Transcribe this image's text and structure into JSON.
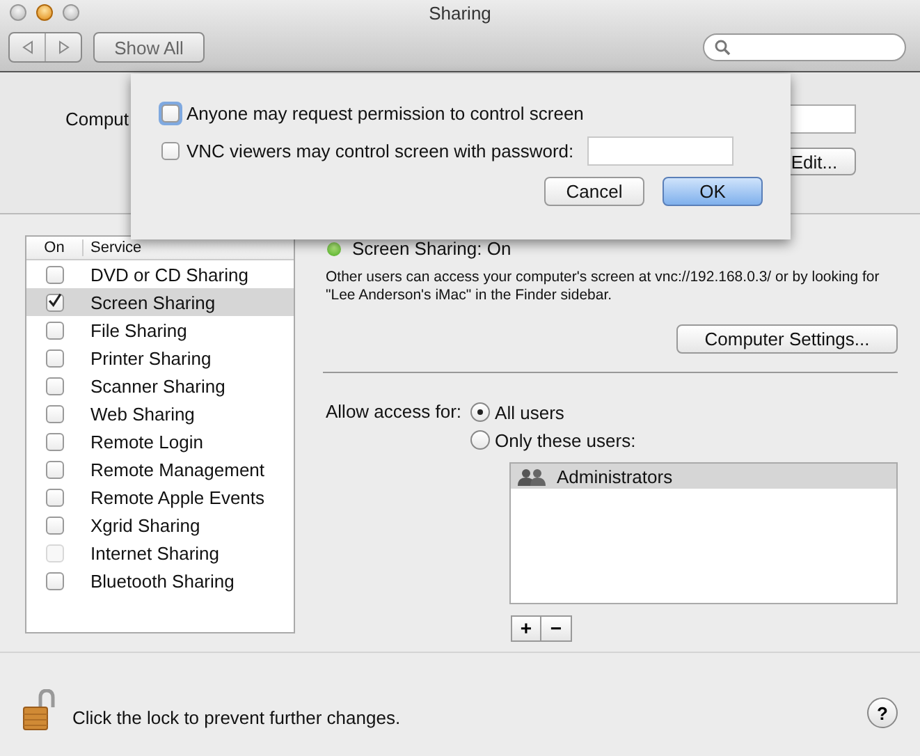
{
  "window": {
    "title": "Sharing"
  },
  "toolbar": {
    "show_all": "Show All"
  },
  "computer_name": {
    "label": "Comput",
    "edit_button": "Edit..."
  },
  "services": {
    "columns": [
      "On",
      "Service"
    ],
    "items": [
      {
        "name": "DVD or CD Sharing",
        "checked": false,
        "selected": false,
        "disabled": false
      },
      {
        "name": "Screen Sharing",
        "checked": true,
        "selected": true,
        "disabled": false
      },
      {
        "name": "File Sharing",
        "checked": false,
        "selected": false,
        "disabled": false
      },
      {
        "name": "Printer Sharing",
        "checked": false,
        "selected": false,
        "disabled": false
      },
      {
        "name": "Scanner Sharing",
        "checked": false,
        "selected": false,
        "disabled": false
      },
      {
        "name": "Web Sharing",
        "checked": false,
        "selected": false,
        "disabled": false
      },
      {
        "name": "Remote Login",
        "checked": false,
        "selected": false,
        "disabled": false
      },
      {
        "name": "Remote Management",
        "checked": false,
        "selected": false,
        "disabled": false
      },
      {
        "name": "Remote Apple Events",
        "checked": false,
        "selected": false,
        "disabled": false
      },
      {
        "name": "Xgrid Sharing",
        "checked": false,
        "selected": false,
        "disabled": false
      },
      {
        "name": "Internet Sharing",
        "checked": false,
        "selected": false,
        "disabled": true
      },
      {
        "name": "Bluetooth Sharing",
        "checked": false,
        "selected": false,
        "disabled": false
      }
    ]
  },
  "status": {
    "text": "Screen Sharing: On",
    "on": true
  },
  "description": "Other users can access your computer's screen at vnc://192.168.0.3/ or by looking for \"Lee Anderson's iMac\" in the Finder sidebar.",
  "computer_settings_button": "Computer Settings...",
  "access": {
    "label": "Allow access for:",
    "options": [
      {
        "label": "All users",
        "selected": true
      },
      {
        "label": "Only these users:",
        "selected": false
      }
    ],
    "users": [
      {
        "name": "Administrators",
        "selected": true
      }
    ],
    "add": "+",
    "remove": "−"
  },
  "sheet": {
    "options": [
      {
        "kind": "checkbox",
        "label": "Anyone may request permission to control screen",
        "checked": false,
        "focused": true
      },
      {
        "kind": "password",
        "label": "VNC viewers may control screen with password:",
        "checked": false,
        "focused": false
      }
    ],
    "buttons": [
      {
        "label": "Cancel",
        "default": false
      },
      {
        "label": "OK",
        "default": true
      }
    ]
  },
  "footer": {
    "lock_text": "Click the lock to prevent further changes.",
    "help": "?"
  }
}
